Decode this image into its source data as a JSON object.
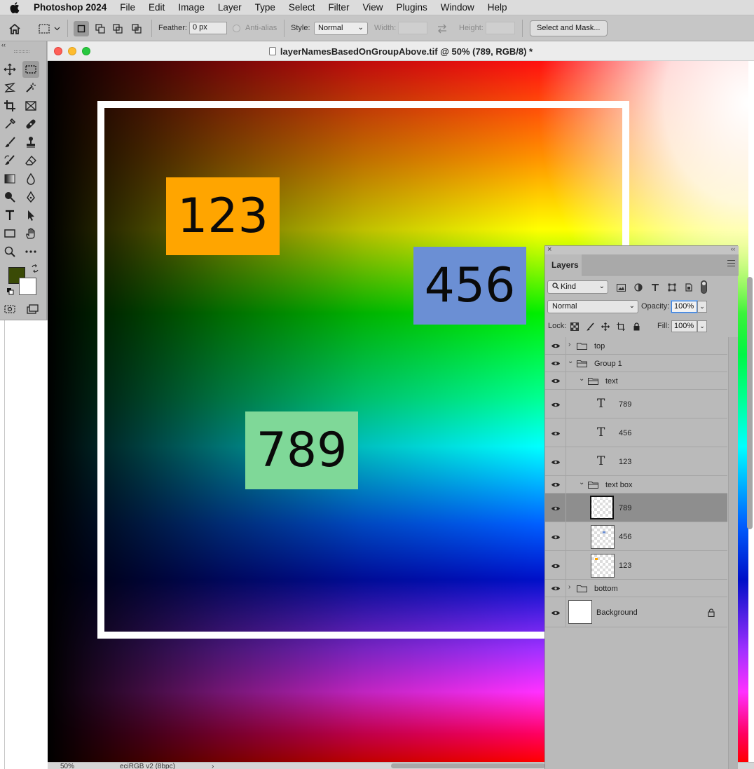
{
  "menubar": {
    "app_name": "Photoshop 2024",
    "items": [
      "File",
      "Edit",
      "Image",
      "Layer",
      "Type",
      "Select",
      "Filter",
      "View",
      "Plugins",
      "Window",
      "Help"
    ]
  },
  "options": {
    "feather_label": "Feather:",
    "feather_value": "0 px",
    "antialias_label": "Anti-alias",
    "style_label": "Style:",
    "style_value": "Normal",
    "width_label": "Width:",
    "height_label": "Height:",
    "select_mask_label": "Select and Mask..."
  },
  "document": {
    "title": "layerNamesBasedOnGroupAbove.tif @ 50% (789, RGB/8) *",
    "zoom": "50%",
    "profile": "eciRGB v2 (8bpc)",
    "boxes": [
      {
        "label": "123",
        "color": "#ffa500"
      },
      {
        "label": "456",
        "color": "#6b8fd4"
      },
      {
        "label": "789",
        "color": "#7fd898"
      }
    ]
  },
  "layers_panel": {
    "tab": "Layers",
    "filter_kind": "Kind",
    "blend_mode": "Normal",
    "opacity_label": "Opacity:",
    "opacity_value": "100%",
    "lock_label": "Lock:",
    "fill_label": "Fill:",
    "fill_value": "100%",
    "layers": [
      {
        "name": "top",
        "kind": "group",
        "state": "collapsed"
      },
      {
        "name": "Group 1",
        "kind": "group",
        "state": "expanded"
      },
      {
        "name": "text",
        "kind": "group",
        "state": "expanded"
      },
      {
        "name": "789",
        "kind": "text"
      },
      {
        "name": "456",
        "kind": "text"
      },
      {
        "name": "123",
        "kind": "text"
      },
      {
        "name": "text box",
        "kind": "group",
        "state": "expanded"
      },
      {
        "name": "789",
        "kind": "pixel",
        "selected": true
      },
      {
        "name": "456",
        "kind": "pixel"
      },
      {
        "name": "123",
        "kind": "pixel"
      },
      {
        "name": "bottom",
        "kind": "group",
        "state": "collapsed"
      },
      {
        "name": "Background",
        "kind": "background",
        "locked": true
      }
    ]
  }
}
